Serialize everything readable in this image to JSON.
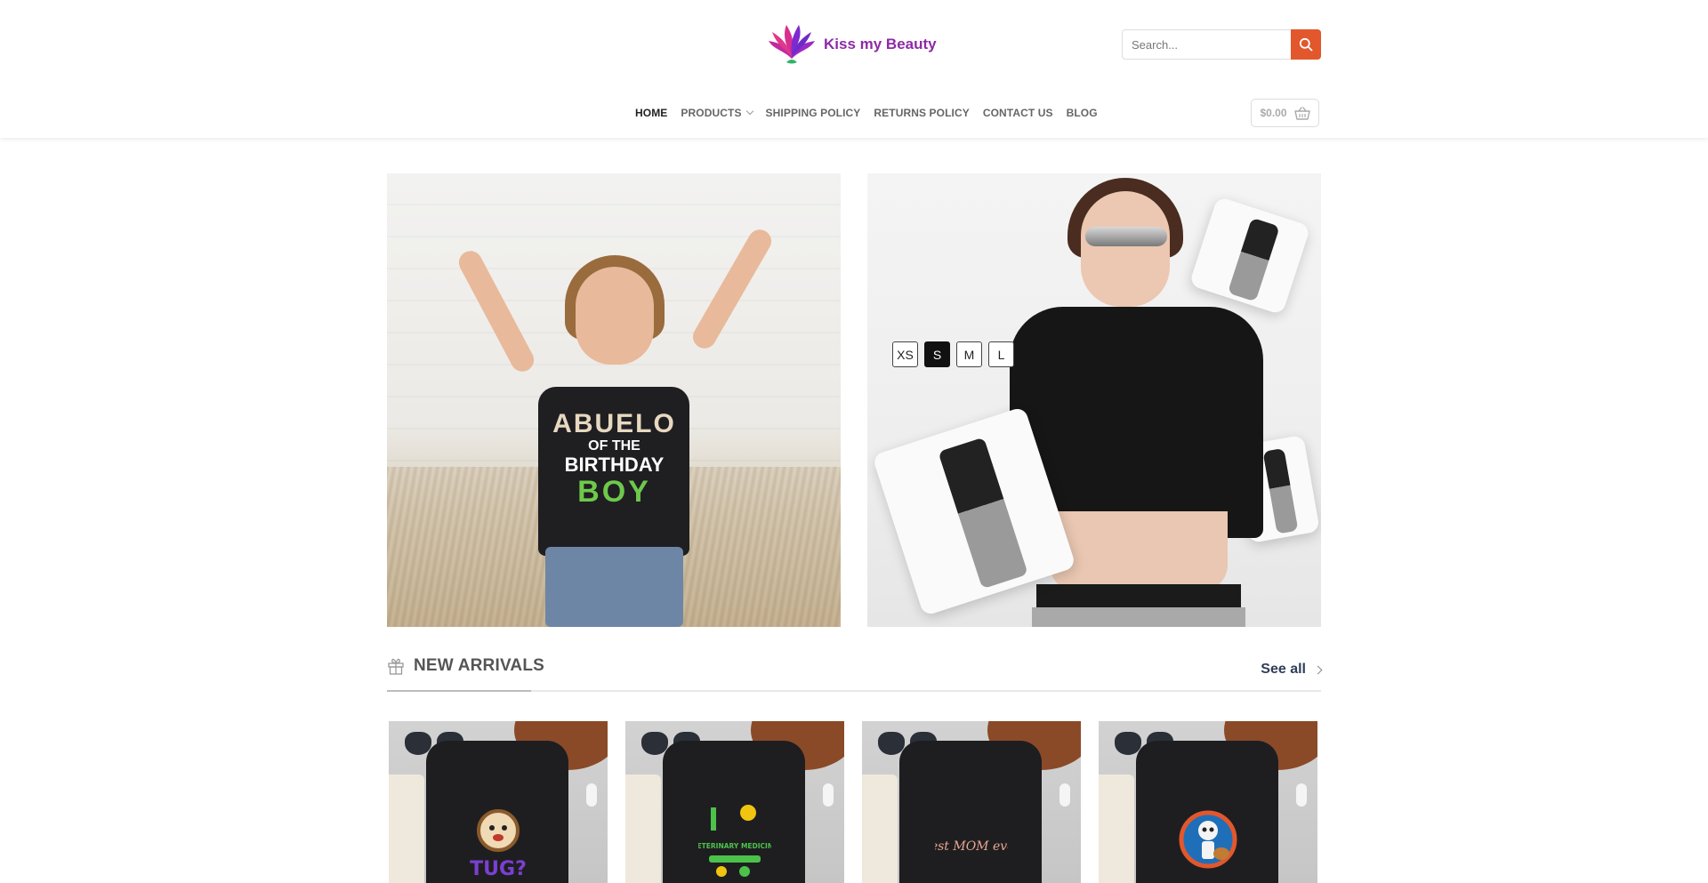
{
  "brand": {
    "name": "Kiss my Beauty"
  },
  "search": {
    "placeholder": "Search...",
    "icon": "search-icon"
  },
  "nav": {
    "items": [
      {
        "label": "HOME",
        "active": true
      },
      {
        "label": "PRODUCTS",
        "has_dropdown": true
      },
      {
        "label": "SHIPPING POLICY"
      },
      {
        "label": "RETURNS POLICY"
      },
      {
        "label": "CONTACT US"
      },
      {
        "label": "BLOG"
      }
    ]
  },
  "cart": {
    "total": "$0.00",
    "icon": "basket-icon"
  },
  "banners": {
    "kid_shirt_print": [
      "ABUELO",
      "OF THE",
      "BIRTHDAY",
      "BOY"
    ],
    "sizes": [
      {
        "label": "XS",
        "selected": false
      },
      {
        "label": "S",
        "selected": true
      },
      {
        "label": "M",
        "selected": false
      },
      {
        "label": "L",
        "selected": false
      }
    ]
  },
  "section": {
    "title": "NEW ARRIVALS",
    "icon": "gift-icon",
    "see_all": "See all"
  },
  "products": [
    {
      "art_icon": "dog-graphic",
      "art_text": "TUG?",
      "art_color": "#7b3fd1"
    },
    {
      "art_icon": "veterinary-graphic",
      "art_text": "VETERINARY MEDICINE",
      "art_color": "#4cc24a"
    },
    {
      "art_icon": "best-mom-graphic",
      "art_text": "best MOM ever",
      "art_color": "#e9a78f"
    },
    {
      "art_icon": "skeleton-guitar-graphic",
      "art_text": "",
      "art_color": "#e2572c"
    }
  ],
  "colors": {
    "accent": "#e2572c",
    "brand": "#8e2aa6",
    "link": "#2f3e58"
  }
}
